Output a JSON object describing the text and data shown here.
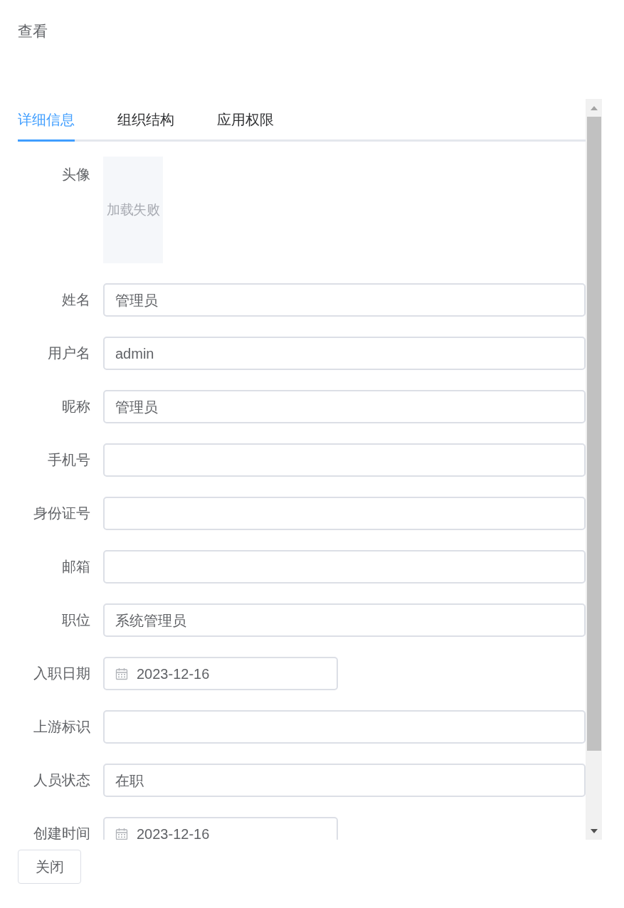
{
  "dialog": {
    "title": "查看"
  },
  "tabs": [
    {
      "label": "详细信息",
      "selected": true
    },
    {
      "label": "组织结构",
      "selected": false
    },
    {
      "label": "应用权限",
      "selected": false
    }
  ],
  "form": [
    {
      "kind": "avatar",
      "label": "头像",
      "value": "加载失败"
    },
    {
      "kind": "text",
      "label": "姓名",
      "value": "管理员"
    },
    {
      "kind": "text",
      "label": "用户名",
      "value": "admin"
    },
    {
      "kind": "text",
      "label": "昵称",
      "value": "管理员"
    },
    {
      "kind": "text",
      "label": "手机号"
    },
    {
      "kind": "text",
      "label": "身份证号"
    },
    {
      "kind": "text",
      "label": "邮箱"
    },
    {
      "kind": "text",
      "label": "职位",
      "value": "系统管理员"
    },
    {
      "kind": "date",
      "label": "入职日期",
      "value": "2023-12-16"
    },
    {
      "kind": "text",
      "label": "上游标识"
    },
    {
      "kind": "text",
      "label": "人员状态",
      "value": "在职"
    },
    {
      "kind": "date",
      "label": "创建时间",
      "value": "2023-12-16"
    }
  ],
  "buttons": [
    "关闭"
  ]
}
